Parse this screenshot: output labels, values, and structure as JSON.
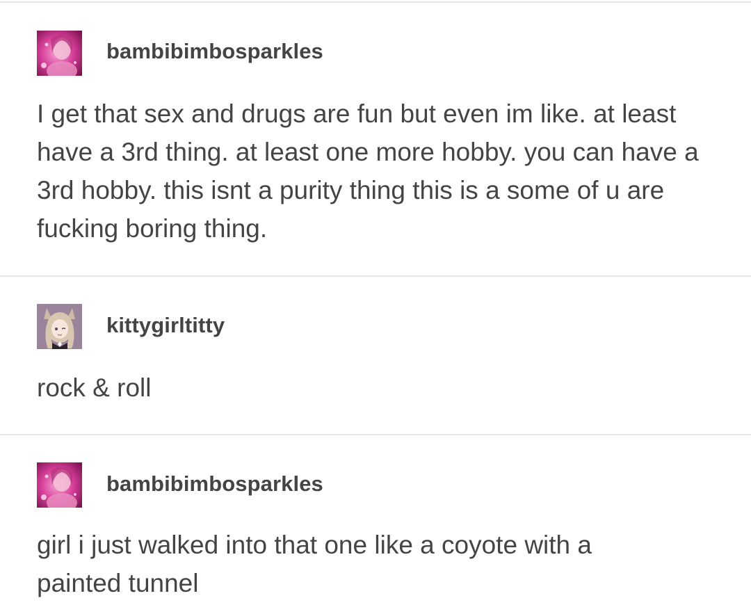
{
  "posts": [
    {
      "username": "bambibimbosparkles",
      "avatar_icon": "avatar-photo-pink",
      "text": "I get that sex and drugs are fun but even im like. at least have a 3rd thing. at least one more hobby. you can have a 3rd hobby. this isnt a purity thing this is a some of u are fucking boring thing."
    },
    {
      "username": "kittygirltitty",
      "avatar_icon": "avatar-anime-catgirl",
      "text": "rock & roll"
    },
    {
      "username": "bambibimbosparkles",
      "avatar_icon": "avatar-photo-pink",
      "text": "girl i just walked into that one like a coyote with a painted tunnel"
    }
  ],
  "colors": {
    "text": "#444444",
    "divider": "#e6e6e6",
    "background": "#ffffff"
  }
}
